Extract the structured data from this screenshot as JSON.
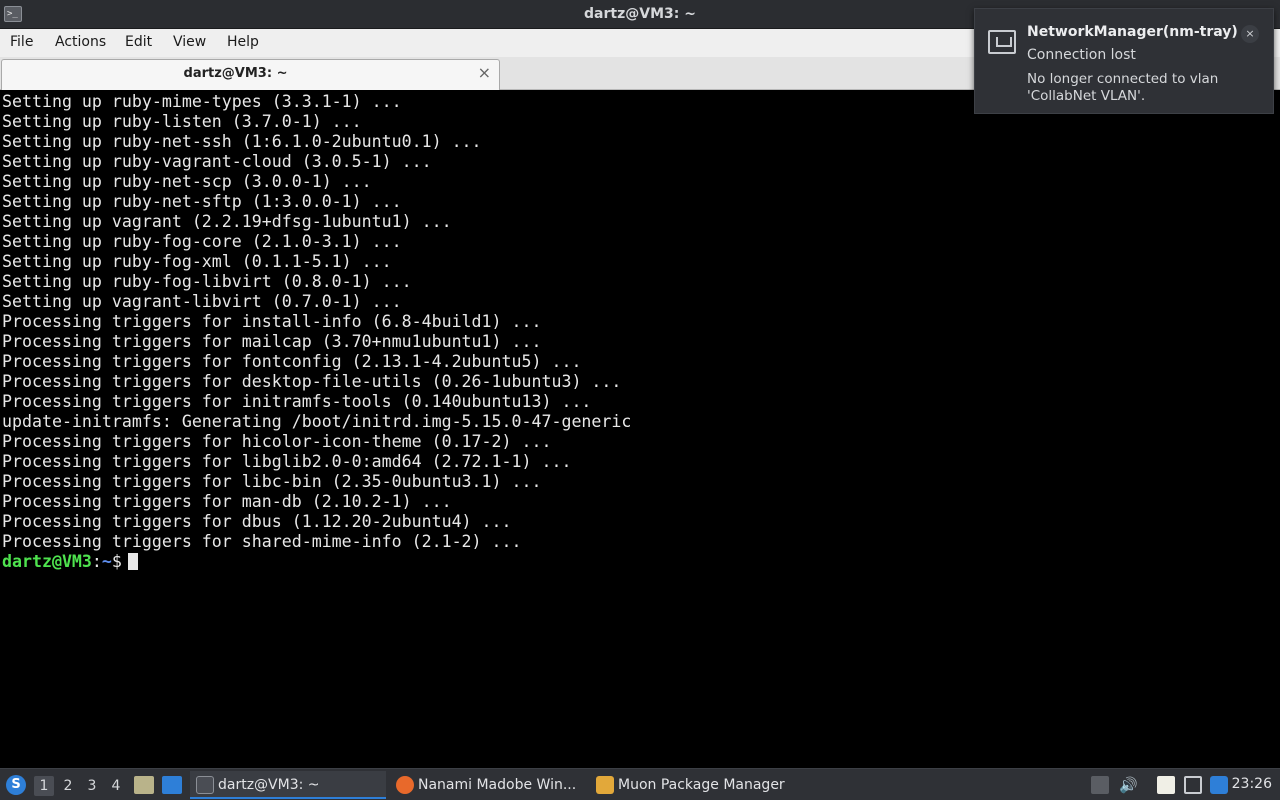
{
  "window": {
    "title": "dartz@VM3: ~"
  },
  "menu": {
    "items": [
      "File",
      "Actions",
      "Edit",
      "View",
      "Help"
    ]
  },
  "tab": {
    "label": "dartz@VM3: ~",
    "close": "×"
  },
  "terminal": {
    "lines": [
      "Setting up ruby-mime-types (3.3.1-1) ...",
      "Setting up ruby-listen (3.7.0-1) ...",
      "Setting up ruby-net-ssh (1:6.1.0-2ubuntu0.1) ...",
      "Setting up ruby-vagrant-cloud (3.0.5-1) ...",
      "Setting up ruby-net-scp (3.0.0-1) ...",
      "Setting up ruby-net-sftp (1:3.0.0-1) ...",
      "Setting up vagrant (2.2.19+dfsg-1ubuntu1) ...",
      "Setting up ruby-fog-core (2.1.0-3.1) ...",
      "Setting up ruby-fog-xml (0.1.1-5.1) ...",
      "Setting up ruby-fog-libvirt (0.8.0-1) ...",
      "Setting up vagrant-libvirt (0.7.0-1) ...",
      "Processing triggers for install-info (6.8-4build1) ...",
      "Processing triggers for mailcap (3.70+nmu1ubuntu1) ...",
      "Processing triggers for fontconfig (2.13.1-4.2ubuntu5) ...",
      "Processing triggers for desktop-file-utils (0.26-1ubuntu3) ...",
      "Processing triggers for initramfs-tools (0.140ubuntu13) ...",
      "update-initramfs: Generating /boot/initrd.img-5.15.0-47-generic",
      "Processing triggers for hicolor-icon-theme (0.17-2) ...",
      "Processing triggers for libglib2.0-0:amd64 (2.72.1-1) ...",
      "Processing triggers for libc-bin (2.35-0ubuntu3.1) ...",
      "Processing triggers for man-db (2.10.2-1) ...",
      "Processing triggers for dbus (1.12.20-2ubuntu4) ...",
      "Processing triggers for shared-mime-info (2.1-2) ..."
    ],
    "prompt": {
      "user": "dartz@VM3",
      "sep": ":",
      "path": "~",
      "symbol": "$"
    }
  },
  "notification": {
    "icon": "network-wired-icon",
    "title": "NetworkManager(nm-tray)",
    "summary": "Connection lost",
    "body": "No longer connected to vlan 'CollabNet VLAN'.",
    "close": "×"
  },
  "taskbar": {
    "workspaces": [
      "1",
      "2",
      "3",
      "4"
    ],
    "active_workspace": "1",
    "tasks": [
      {
        "label": "dartz@VM3: ~",
        "icon": "terminal-icon",
        "color": "#4a4d54"
      },
      {
        "label": "Nanami Madobe Win...",
        "icon": "firefox-icon",
        "color": "#e8692b"
      },
      {
        "label": "Muon Package Manager",
        "icon": "package-icon",
        "color": "#e2a83a"
      }
    ],
    "clock": "23:26"
  },
  "colors": {
    "prompt_user": "#4ee34e",
    "prompt_path": "#5f8ff0",
    "accent": "#2e7fd8"
  }
}
